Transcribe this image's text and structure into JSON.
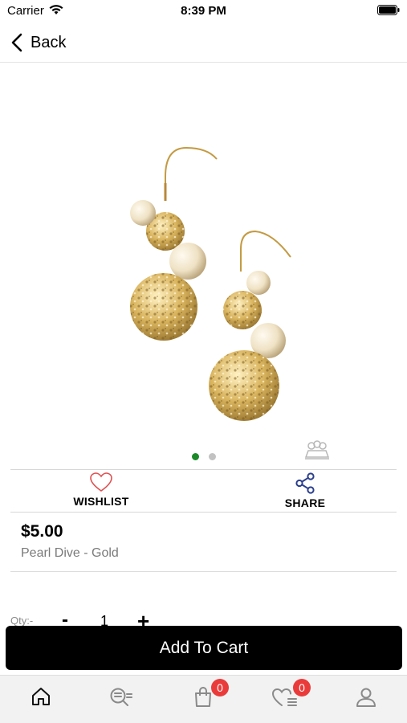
{
  "status_bar": {
    "carrier": "Carrier",
    "time": "8:39 PM"
  },
  "nav": {
    "back_label": "Back"
  },
  "carousel": {
    "page_count": 2,
    "active_page": 1,
    "active_color": "#1a8a28",
    "inactive_color": "#c2c2c2"
  },
  "actions": {
    "wishlist_label": "WISHLIST",
    "share_label": "SHARE"
  },
  "product": {
    "price": "$5.00",
    "name": "Pearl Dive - Gold"
  },
  "quantity": {
    "label": "Qty:-",
    "minus": "-",
    "value": "1",
    "plus": "+"
  },
  "add_to_cart_label": "Add To Cart",
  "tabs": {
    "home_icon": "home-icon",
    "search_icon": "search-list-icon",
    "cart_icon": "shopping-bag-icon",
    "cart_badge": "0",
    "wishlist_icon": "heart-list-icon",
    "wishlist_badge": "0",
    "account_icon": "user-icon"
  },
  "colors": {
    "badge": "#ea3b3b",
    "wishlist_icon": "#e05050",
    "share_icon": "#2b3f8c",
    "button": "#000000"
  }
}
